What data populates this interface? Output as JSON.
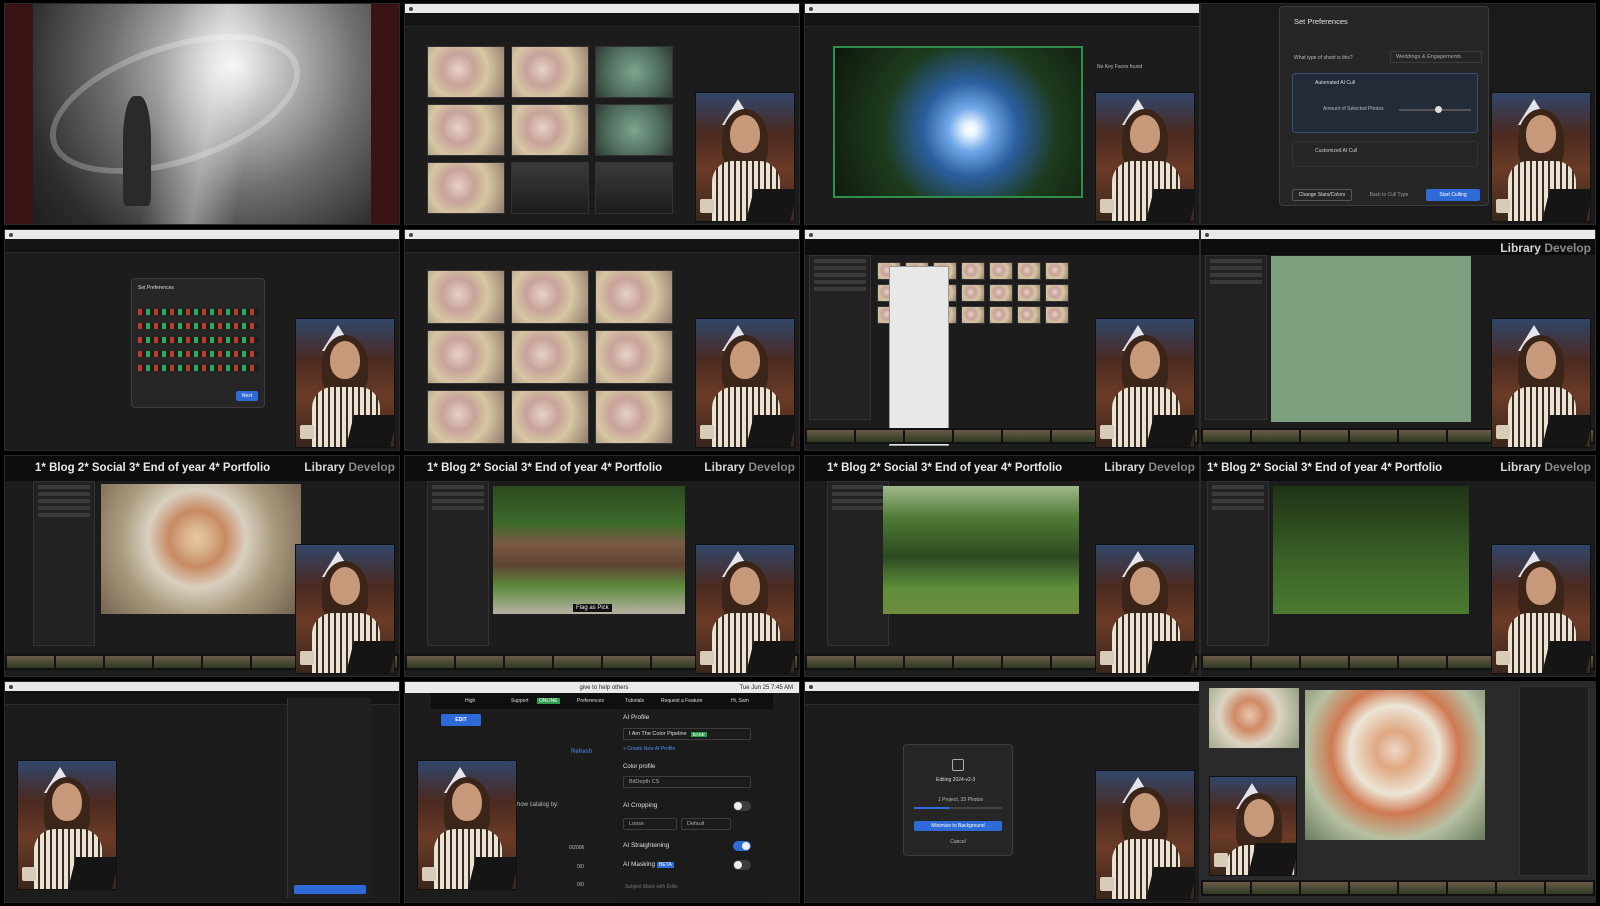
{
  "lightroom_header": {
    "presets": "1* Blog 2* Social 3* End of year 4* Portfolio",
    "module_library": "Library",
    "module_develop": "Develop"
  },
  "tile_2_2": {
    "flag_tooltip": "Flag as Pick"
  },
  "tile_1_3": {
    "dialog_title": "Set Preferences",
    "question": "What type of shoot is this?",
    "shoot_type": "Weddings & Engagements",
    "automated_cull": "Automated AI Cull",
    "customized_cull": "Customized AI Cull",
    "amount_label": "Amount of Selected Photos",
    "btn_change_stars": "Change Stars/Colors",
    "btn_back": "Back to Cull Type",
    "btn_start": "Start Culling"
  },
  "tile_1_1": {
    "empty_state": "No Key Faces found"
  },
  "tile_2_1": {
    "dialog_title": "Set Preferences",
    "btn_done": "Next"
  },
  "tile_4_2": {
    "menubar_text": "give to help others",
    "menubar_time": "Tue Jun 25 7:45 AM",
    "quality": "High",
    "nav_support": "Support",
    "support_badge": "ONLINE",
    "nav_preferences": "Preferences",
    "nav_tutorials": "Tutorials",
    "nav_request": "Request a Feature",
    "greeting": "Hi, Sam",
    "edit_button": "EDIT",
    "refresh": "Refresh",
    "show_catalog": "how catalog by:",
    "count_1": "0/2006",
    "count_2": "0/0",
    "count_3": "0/0",
    "ai_profile_heading": "AI Profile",
    "profile_name": "I Am The Color Pipeline",
    "profile_badge": "BASE",
    "create_profile": "+ Create New AI Profile",
    "color_profile_heading": "Color profile",
    "color_profile_value": "BitDepth CS",
    "ai_cropping": "AI Cropping",
    "crop_mode": "Loose",
    "crop_ratio": "Default",
    "ai_straightening": "AI Straightening",
    "ai_masking": "AI Masking",
    "masking_badge": "BETA",
    "subject_mask": "Subject Mask with Edits"
  },
  "tile_4_3": {
    "dialog_title": "Editing 2024-v2-3",
    "progress_text": "1 Project, 33 Photos",
    "btn_primary": "Minimize to Background",
    "btn_cancel": "Cancel"
  }
}
